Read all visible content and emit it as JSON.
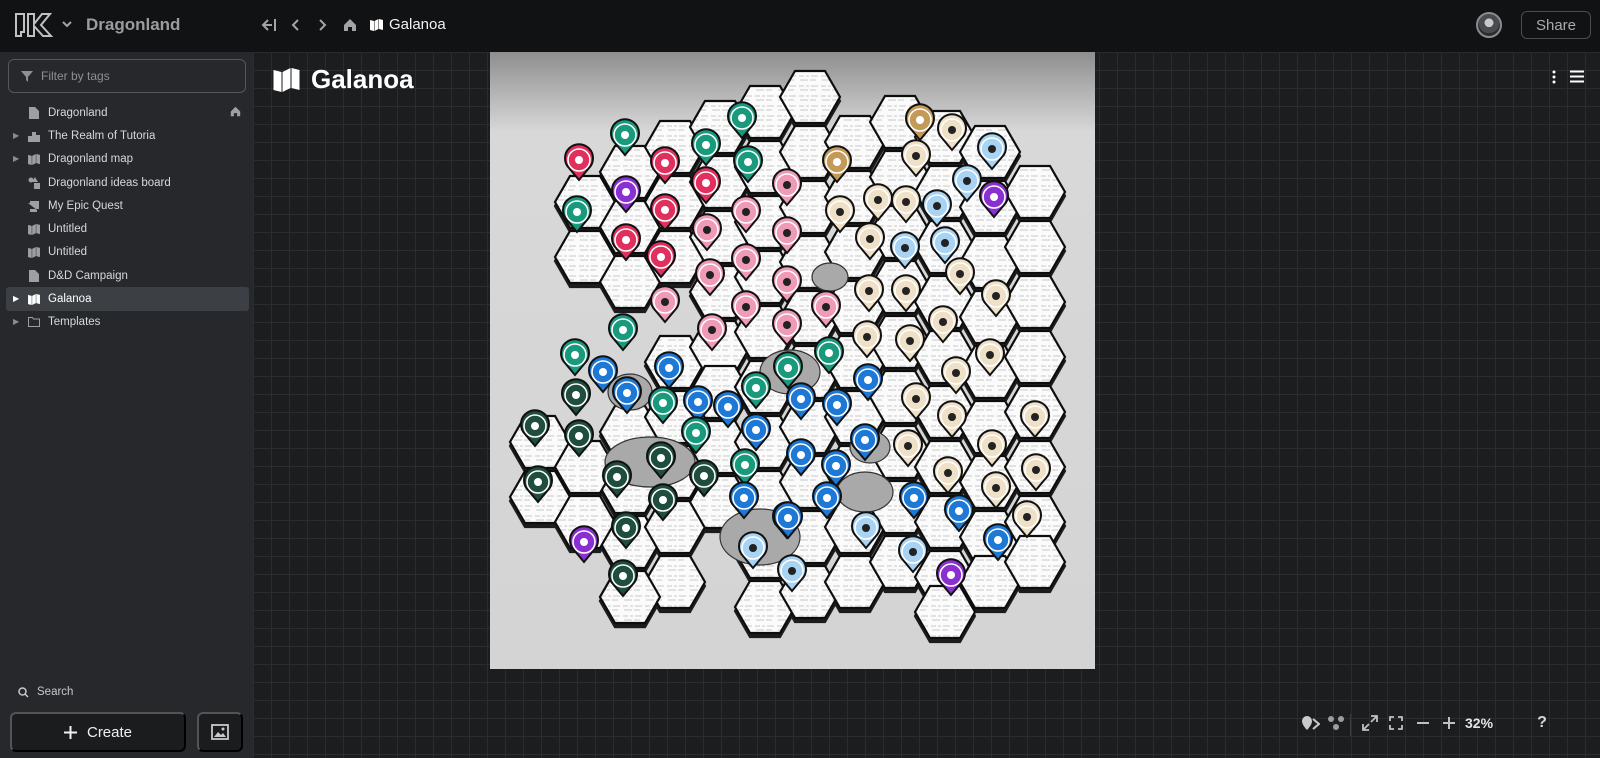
{
  "header": {
    "app_title": "Dragonland",
    "breadcrumb_current": "Galanoa",
    "share_label": "Share"
  },
  "sidebar": {
    "filter_placeholder": "Filter by tags",
    "items": [
      {
        "label": "Dragonland",
        "icon": "document-icon",
        "expandable": false,
        "home": true
      },
      {
        "label": "The Realm of Tutoria",
        "icon": "buildings-icon",
        "expandable": true
      },
      {
        "label": "Dragonland map",
        "icon": "map-icon",
        "expandable": true
      },
      {
        "label": "Dragonland ideas board",
        "icon": "board-icon",
        "expandable": false
      },
      {
        "label": "My Epic Quest",
        "icon": "scroll-icon",
        "expandable": false
      },
      {
        "label": "Untitled",
        "icon": "map-icon",
        "expandable": false
      },
      {
        "label": "Untitled",
        "icon": "map-icon",
        "expandable": false
      },
      {
        "label": "D&D Campaign",
        "icon": "document-icon",
        "expandable": false
      },
      {
        "label": "Galanoa",
        "icon": "map-icon",
        "expandable": true,
        "selected": true
      },
      {
        "label": "Templates",
        "icon": "folder-icon",
        "expandable": true
      }
    ],
    "search_label": "Search",
    "create_label": "Create"
  },
  "main": {
    "page_title": "Galanoa",
    "zoom_level": "32%"
  },
  "colors": {
    "forest": "#1a9a7d",
    "city_red": "#e0305e",
    "poi_pink": "#ef9ab6",
    "desert": "#efe0c8",
    "ice": "#a9d3f2",
    "water": "#1d78d6",
    "jungle": "#1f4d3e",
    "gate": "#c39a58",
    "magic": "#8a2fd0"
  }
}
